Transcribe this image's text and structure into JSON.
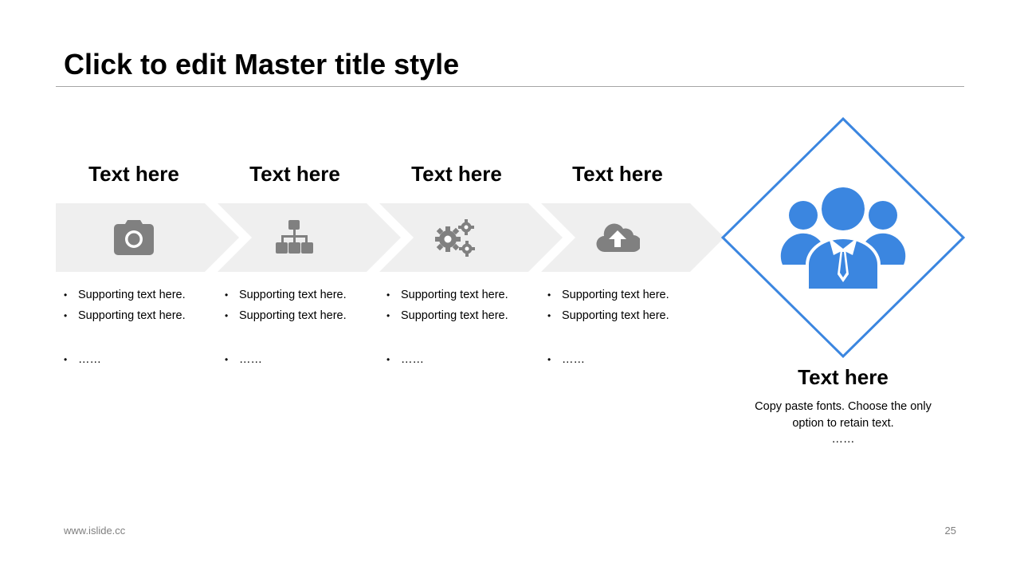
{
  "slide": {
    "title": "Click to edit Master title style",
    "footer_url": "www.islide.cc",
    "page_number": "25"
  },
  "steps": [
    {
      "heading": "Text here",
      "icon": "camera-icon",
      "bullets": [
        "Supporting text here.",
        "Supporting text here.",
        "……"
      ]
    },
    {
      "heading": "Text here",
      "icon": "org-chart-icon",
      "bullets": [
        "Supporting text here.",
        "Supporting text here.",
        "……"
      ]
    },
    {
      "heading": "Text here",
      "icon": "gears-icon",
      "bullets": [
        "Supporting text here.",
        "Supporting text here.",
        "……"
      ]
    },
    {
      "heading": "Text here",
      "icon": "cloud-upload-icon",
      "bullets": [
        "Supporting text here.",
        "Supporting text here.",
        "……"
      ]
    }
  ],
  "result": {
    "icon": "team-icon",
    "heading": "Text here",
    "description": "Copy paste fonts. Choose the only option to retain text.",
    "ellipsis": "……"
  },
  "colors": {
    "accent": "#3b86e0",
    "chevron_fill": "#efefef",
    "icon_gray": "#808080",
    "rule": "#a6a6a6",
    "footer_text": "#7f7f7f"
  }
}
